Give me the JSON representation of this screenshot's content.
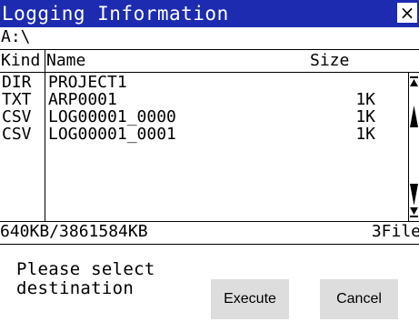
{
  "window": {
    "title": "Logging Information",
    "close_glyph": "×"
  },
  "path": "A:\\",
  "columns": {
    "kind": "Kind",
    "name": "Name",
    "size": "Size"
  },
  "files": [
    {
      "kind": "DIR",
      "name": "PROJECT1",
      "size": ""
    },
    {
      "kind": "TXT",
      "name": "ARP0001",
      "size": "1K"
    },
    {
      "kind": "CSV",
      "name": "LOG00001_0000",
      "size": "1K"
    },
    {
      "kind": "CSV",
      "name": "LOG00001_0001",
      "size": "1K"
    }
  ],
  "scrollbar": {
    "icons": [
      "scroll-top-icon",
      "scroll-up-icon",
      "scroll-down-icon",
      "scroll-bottom-icon"
    ]
  },
  "status": {
    "capacity": "640KB/3861584KB",
    "file_count": "3File"
  },
  "message": "Please select\ndestination",
  "buttons": {
    "execute": "Execute",
    "cancel": "Cancel"
  },
  "colors": {
    "titlebar": "#1c2bb0",
    "title_text": "#ffffff",
    "button_bg": "#dddddd"
  }
}
